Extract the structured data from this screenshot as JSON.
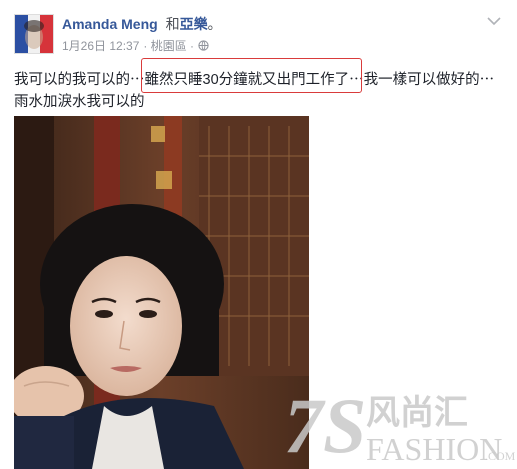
{
  "post": {
    "author": "Amanda Meng",
    "with_prefix": "和",
    "with_name": "亞樂",
    "with_suffix": "。",
    "timestamp": "1月26日 12:37",
    "location": "· 桃園區 ·",
    "text_part1": "我可以的我可以的⋯",
    "text_highlight": "雖然只睡30分鐘就又出門工作了⋯",
    "text_part2": "我一樣可以做好的⋯雨水加淚水我可以的",
    "privacy_icon": "globe-icon",
    "menu_icon": "chevron-down-icon"
  },
  "watermark": {
    "brand_digits": "7S",
    "brand_chinese": "风尚汇",
    "brand_latin": "FASHION",
    "brand_suffix": ".COM"
  },
  "colors": {
    "name_link": "#365899",
    "meta_gray": "#90949c",
    "highlight_border": "#d93b3b",
    "watermark": "#c9c9c9"
  }
}
